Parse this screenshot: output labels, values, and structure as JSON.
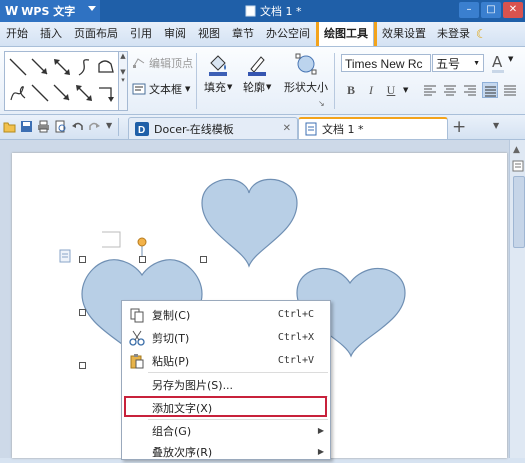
{
  "titlebar": {
    "app_name": "WPS 文字",
    "document_title": "文档 1 *"
  },
  "menubar": {
    "items": [
      "开始",
      "插入",
      "页面布局",
      "引用",
      "审阅",
      "视图",
      "章节",
      "办公空间",
      "绘图工具",
      "效果设置",
      "未登录"
    ]
  },
  "ribbon": {
    "edit_vertex_label": "编辑顶点",
    "text_box_label": "文本框",
    "fill_label": "填充",
    "outline_label": "轮廓",
    "shape_size_label": "形状大小",
    "font_name": "Times New Rc",
    "font_size": "五号",
    "bold_glyph": "B",
    "italic_glyph": "I",
    "underline_glyph": "U"
  },
  "tabs": {
    "docer_tab": "Docer-在线模板",
    "doc_tab": "文档 1 *",
    "new_tab_glyph": "+"
  },
  "context_menu": {
    "copy": {
      "label": "复制(C)",
      "shortcut": "Ctrl+C"
    },
    "cut": {
      "label": "剪切(T)",
      "shortcut": "Ctrl+X"
    },
    "paste": {
      "label": "粘贴(P)",
      "shortcut": "Ctrl+V"
    },
    "save_as_image": {
      "label": "另存为图片(S)..."
    },
    "add_text": {
      "label": "添加文字(X)"
    },
    "group": {
      "label": "组合(G)"
    },
    "order": {
      "label": "叠放次序(R)"
    }
  },
  "colors": {
    "titlebar": "#1f5fa8",
    "heart_fill": "#b8cfe6",
    "heart_stroke": "#6f8fb3",
    "highlight_border": "#c8213b",
    "tab_accent": "#f3a31b"
  }
}
